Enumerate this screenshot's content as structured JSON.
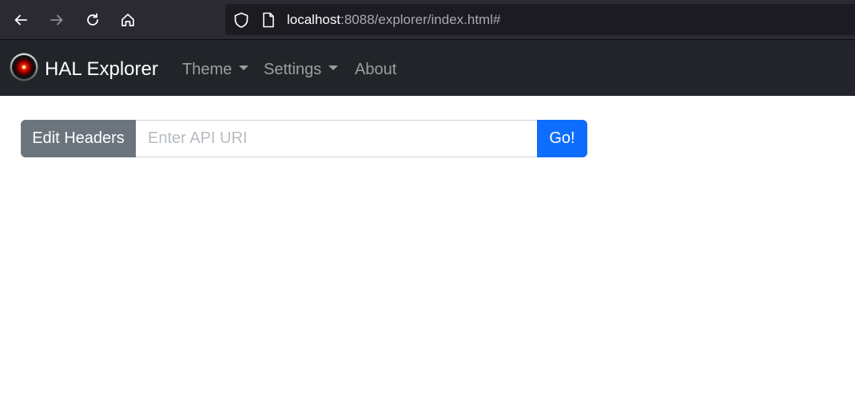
{
  "browser": {
    "url_host": "localhost",
    "url_rest": ":8088/explorer/index.html#",
    "icons": [
      "back-arrow-icon",
      "forward-arrow-icon",
      "reload-icon",
      "home-icon",
      "shield-icon",
      "page-icon"
    ]
  },
  "navbar": {
    "brand": "HAL Explorer",
    "brand_icon": "hal9000-eye-icon",
    "items": [
      {
        "label": "Theme",
        "dropdown": true
      },
      {
        "label": "Settings",
        "dropdown": true
      },
      {
        "label": "About",
        "dropdown": false
      }
    ],
    "background": "#212529"
  },
  "request": {
    "edit_headers_label": "Edit Headers",
    "uri_placeholder": "Enter API URI",
    "uri_value": "",
    "go_label": "Go!"
  },
  "colors": {
    "secondary": "#6c757d",
    "primary": "#0d6efd"
  }
}
